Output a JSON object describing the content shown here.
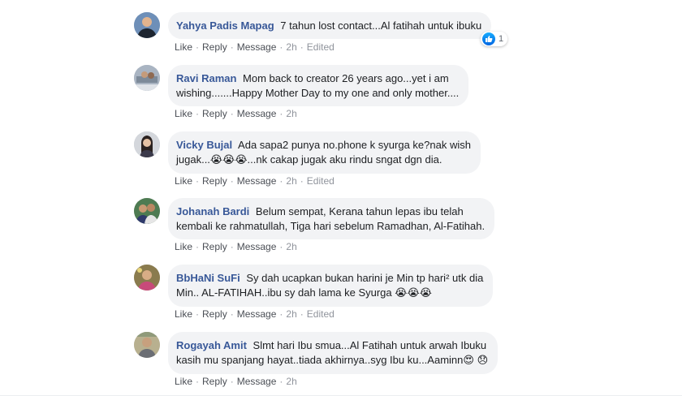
{
  "comments": [
    {
      "author": "Yahya Padis Mapag",
      "text_lines": [
        "7 tahun lost contact...Al fatihah untuk ibuku"
      ],
      "actions": {
        "like": "Like",
        "reply": "Reply",
        "message": "Message",
        "time": "2h",
        "edited": "Edited"
      },
      "reaction_count": "1"
    },
    {
      "author": "Ravi Raman",
      "text_lines": [
        "Mom back to creator 26 years ago...yet i am",
        "wishing.......Happy Mother Day to my one and only mother...."
      ],
      "actions": {
        "like": "Like",
        "reply": "Reply",
        "message": "Message",
        "time": "2h",
        "edited": ""
      }
    },
    {
      "author": "Vicky Bujal",
      "text_lines": [
        "Ada sapa2 punya no.phone k syurga ke?nak wish",
        "jugak...",
        "...nk cakap jugak aku rindu sngat dgn dia."
      ],
      "emoji": [
        "😭",
        "😭",
        "😭"
      ],
      "actions": {
        "like": "Like",
        "reply": "Reply",
        "message": "Message",
        "time": "2h",
        "edited": "Edited"
      }
    },
    {
      "author": "Johanah Bardi",
      "text_lines": [
        "Belum sempat, Kerana tahun lepas ibu telah",
        "kembali ke rahmatullah, Tiga hari sebelum Ramadhan, Al-Fatihah."
      ],
      "actions": {
        "like": "Like",
        "reply": "Reply",
        "message": "Message",
        "time": "2h",
        "edited": ""
      }
    },
    {
      "author": "BbHaNi SuFi",
      "text_lines": [
        "Sy dah ucapkan bukan harini je Min tp hari² utk dia",
        "Min.. AL-FATIHAH..ibu sy dah lama ke Syurga"
      ],
      "emoji": [
        "😭",
        "😭",
        "😭"
      ],
      "actions": {
        "like": "Like",
        "reply": "Reply",
        "message": "Message",
        "time": "2h",
        "edited": "Edited"
      }
    },
    {
      "author": "Rogayah Amit",
      "text_lines": [
        "Slmt hari Ibu smua...Al Fatihah untuk arwah Ibuku",
        "kasih mu spanjang hayat..tiada akhirnya..syg Ibu ku...Aaminn"
      ],
      "emoji": [
        "😍",
        "😞"
      ],
      "actions": {
        "like": "Like",
        "reply": "Reply",
        "message": "Message",
        "time": "2h",
        "edited": ""
      }
    }
  ]
}
